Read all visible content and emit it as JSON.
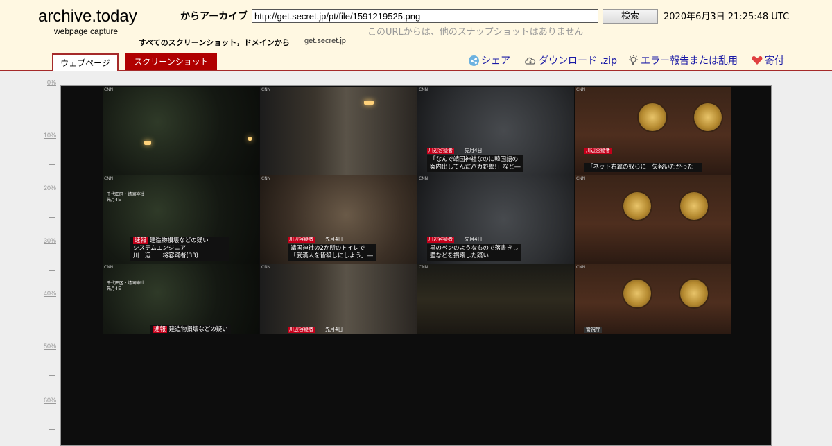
{
  "header": {
    "logo": "archive.today",
    "logo_sub": "webpage capture",
    "from_label": "からアーカイブ",
    "url_value": "http://get.secret.jp/pt/file/1591219525.png",
    "search_button": "検索",
    "timestamp": "2020年6月3日 21:25:48 UTC",
    "no_snapshots": "このURLからは、他のスナップショットはありません",
    "all_screenshots_label": "すべてのスクリーンショット，ドメインから",
    "domain_link": "get.secret.jp"
  },
  "tabs": {
    "webpage": "ウェブページ",
    "screenshot": "スクリーンショット"
  },
  "actions": {
    "share": "シェア",
    "download": "ダウンロード .zip",
    "report": "エラー報告または乱用",
    "donate": "寄付"
  },
  "ruler": [
    "0%",
    "10%",
    "20%",
    "30%",
    "40%",
    "50%",
    "60%"
  ],
  "colors": {
    "header_bg": "#fff8e2",
    "accent": "#a52a2a",
    "screenshot_tab": "#b00000",
    "link": "#1a1aa6"
  },
  "captures": {
    "corner": "CNN",
    "tag": "川辺容疑者",
    "date": "先月4日",
    "loc_line1": "千代田区・靖国神社",
    "loc_line2": "先月4日",
    "c7_line1": "「なんで靖国神社なのに韓国語の",
    "c7_line2": "案内出してんだバカ野郎!」など―",
    "c8_line1": "「ネット右翼の奴らに一矢報いたかった」",
    "c9_tag": "速報",
    "c9_line0": "建造物損壊などの疑い",
    "c9_line1": "システムエンジニア",
    "c9_line2": "川　辺　　将容疑者(33)",
    "c10_line1": "靖国神社の2か所のトイレで",
    "c10_line2": "「武漢人を皆殺しにしよう」―",
    "c11_line1": "黒のペンのようなもので落書きし",
    "c11_line2": "壁などを損壊した疑い",
    "c13_line0": "建造物損壊などの疑い",
    "c16_tag": "警視庁"
  }
}
